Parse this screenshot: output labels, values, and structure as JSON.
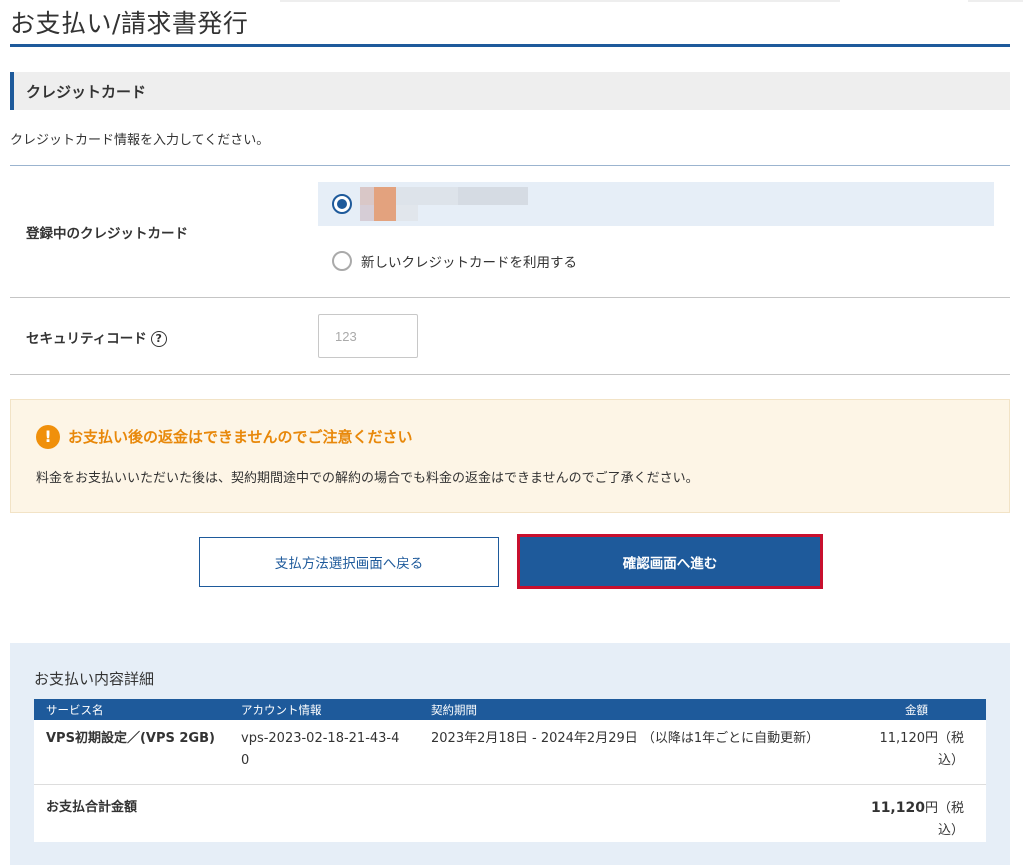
{
  "page": {
    "title": "お支払い/請求書発行"
  },
  "section": {
    "header": "クレジットカード",
    "intro": "クレジットカード情報を入力してください。"
  },
  "card": {
    "label": "登録中のクレジットカード",
    "new_card_label": "新しいクレジットカードを利用する"
  },
  "security": {
    "label": "セキュリティコード",
    "help_icon": "?",
    "placeholder": "123"
  },
  "notice": {
    "icon": "!",
    "title": "お支払い後の返金はできませんのでご注意ください",
    "text": "料金をお支払いいただいた後は、契約期間途中での解約の場合でも料金の返金はできませんのでご了承ください。"
  },
  "buttons": {
    "back": "支払方法選択画面へ戻る",
    "next": "確認画面へ進む"
  },
  "details": {
    "title": "お支払い内容詳細",
    "columns": [
      "サービス名",
      "アカウント情報",
      "契約期間",
      "金額"
    ],
    "row": {
      "service": "VPS初期設定／(VPS 2GB)",
      "account": "vps-2023-02-18-21-43-40",
      "period": "2023年2月18日 - 2024年2月29日 （以降は1年ごとに自動更新）",
      "amount": "11,120円（税込）"
    },
    "total": {
      "label": "お支払合計金額",
      "amount": "11,120",
      "suffix": "円（税込）"
    }
  },
  "colors": {
    "accent": "#1e5a9b",
    "warning": "#f0900b",
    "highlight_border": "#c8102e"
  }
}
